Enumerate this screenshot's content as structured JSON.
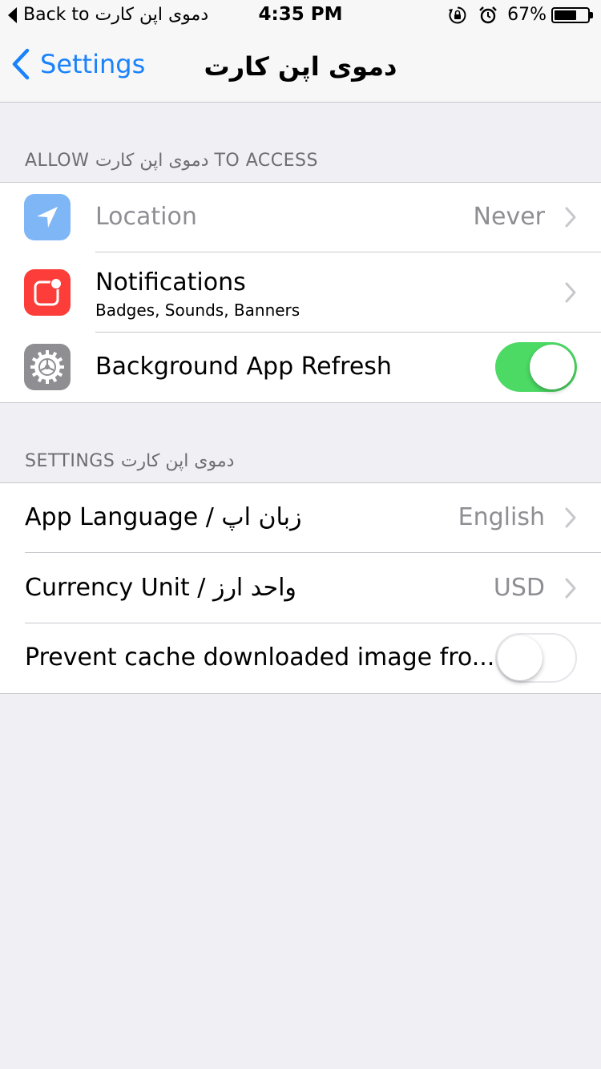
{
  "status_bar": {
    "back_label": "Back to دموی اپن کارت",
    "time": "4:35 PM",
    "battery_percent": "67%",
    "battery_level": 0.67
  },
  "nav": {
    "back_label": "Settings",
    "title": "دموی اپن کارت"
  },
  "access_section": {
    "header": "ALLOW دموی اپن کارت TO ACCESS",
    "location": {
      "label": "Location",
      "value": "Never",
      "icon": "location-arrow-icon",
      "icon_color": "#7fb6f5"
    },
    "notifications": {
      "label": "Notifications",
      "subtitle": "Badges, Sounds, Banners",
      "icon": "notifications-icon",
      "icon_color": "#fc3d39"
    },
    "background_refresh": {
      "label": "Background App Refresh",
      "icon": "gear-icon",
      "icon_color": "#8e8e93",
      "enabled": true
    }
  },
  "settings_section": {
    "header": "SETTINGS دموی اپن کارت",
    "language": {
      "label": "App Language / زبان اپ",
      "value": "English"
    },
    "currency": {
      "label": "Currency Unit / واحد ارز",
      "value": "USD"
    },
    "prevent_cache": {
      "label": "Prevent cache downloaded image fro...",
      "enabled": false
    }
  },
  "colors": {
    "accent": "#1a82fb",
    "toggle_on": "#4cd964",
    "background": "#efeff4",
    "secondary_text": "#8e8e93"
  }
}
